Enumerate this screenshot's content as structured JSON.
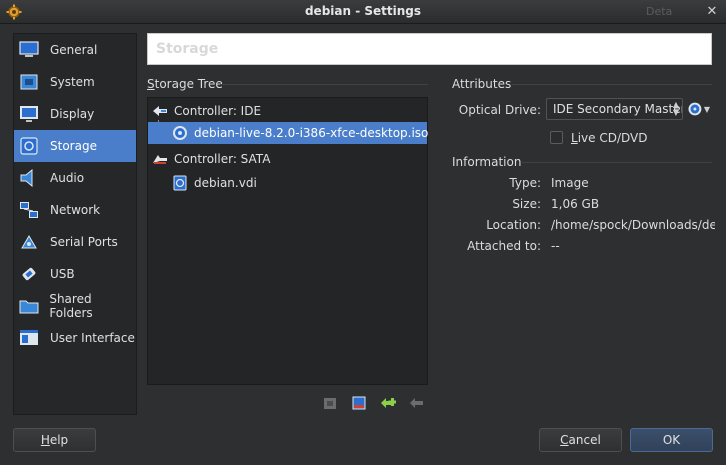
{
  "window": {
    "title": "debian - Settings",
    "ghost_tab": "Deta"
  },
  "sidebar": {
    "items": [
      {
        "label": "General",
        "icon": "general-icon"
      },
      {
        "label": "System",
        "icon": "system-icon"
      },
      {
        "label": "Display",
        "icon": "display-icon"
      },
      {
        "label": "Storage",
        "icon": "storage-icon",
        "active": true
      },
      {
        "label": "Audio",
        "icon": "audio-icon"
      },
      {
        "label": "Network",
        "icon": "network-icon"
      },
      {
        "label": "Serial Ports",
        "icon": "serial-ports-icon"
      },
      {
        "label": "USB",
        "icon": "usb-icon"
      },
      {
        "label": "Shared Folders",
        "icon": "shared-folders-icon"
      },
      {
        "label": "User Interface",
        "icon": "user-interface-icon"
      }
    ]
  },
  "page": {
    "header": "Storage"
  },
  "storage_tree": {
    "label_pre": "",
    "label_u": "S",
    "label_post": "torage Tree",
    "rows": [
      {
        "label": "Controller: IDE",
        "icon": "ide-controller-icon"
      },
      {
        "label": "debian-live-8.2.0-i386-xfce-desktop.iso",
        "icon": "optical-disc-icon",
        "selected": true
      },
      {
        "label": "Controller: SATA",
        "icon": "sata-controller-icon"
      },
      {
        "label": "debian.vdi",
        "icon": "hard-disk-icon"
      }
    ],
    "toolbar": [
      "add-controller-icon",
      "remove-controller-icon",
      "add-attachment-icon",
      "remove-attachment-icon"
    ]
  },
  "attributes": {
    "heading": "Attributes",
    "optical_drive_label_pre": "Optical Drive",
    "optical_drive_label_u": "",
    "optical_drive_value": "IDE Secondary Master",
    "live_cd_pre": "",
    "live_cd_u": "L",
    "live_cd_post": "ive CD/DVD",
    "live_cd_checked": false
  },
  "information": {
    "heading": "Information",
    "rows": [
      {
        "label": "Type:",
        "value": "Image"
      },
      {
        "label": "Size:",
        "value": "1,06 GB"
      },
      {
        "label": "Location:",
        "value": "/home/spock/Downloads/de..."
      },
      {
        "label": "Attached to:",
        "value": "--"
      }
    ]
  },
  "buttons": {
    "help_u": "H",
    "help_rest": "elp",
    "cancel_u": "C",
    "cancel_rest": "ancel",
    "ok": "OK"
  },
  "colors": {
    "accent": "#4a7ecb",
    "background": "#2d2f31"
  }
}
